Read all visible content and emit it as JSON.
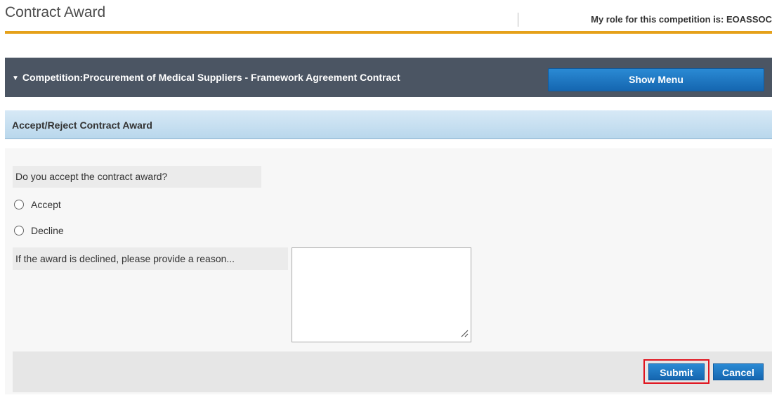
{
  "header": {
    "title": "Contract Award",
    "role_text": "My role for this competition is: EOASSOC"
  },
  "competition": {
    "title": "Competition:Procurement of Medical Suppliers - Framework Agreement Contract",
    "show_menu_label": "Show Menu"
  },
  "section": {
    "title": "Accept/Reject Contract Award"
  },
  "form": {
    "question": "Do you accept the contract award?",
    "options": [
      {
        "label": "Accept"
      },
      {
        "label": "Decline"
      }
    ],
    "reason_label": "If the award is declined, please provide a reason...",
    "reason_value": ""
  },
  "actions": {
    "submit_label": "Submit",
    "cancel_label": "Cancel"
  },
  "colors": {
    "accent_orange": "#e5a11a",
    "button_blue": "#1a74c2",
    "highlight_red": "#e0141e"
  }
}
